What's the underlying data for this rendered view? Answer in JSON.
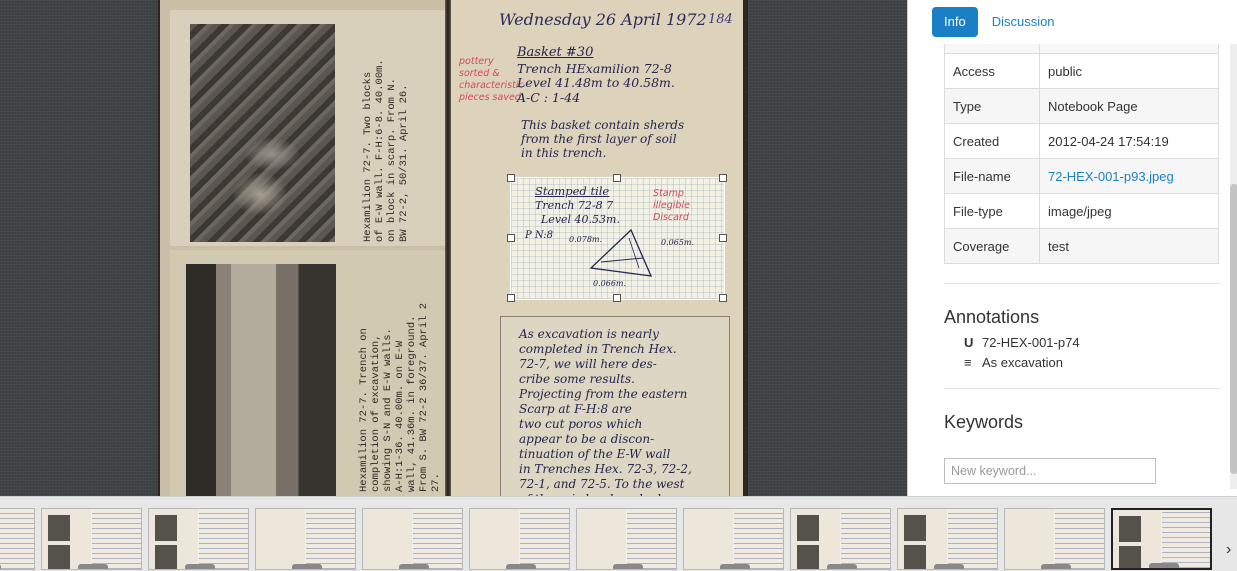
{
  "notebook": {
    "date": "Wednesday 26 April 1972",
    "page_number": "184",
    "red_note": "pottery\nsorted &\ncharacteristic\npieces saved",
    "basket_lines": [
      "Basket #30",
      "Trench HExamilion 72-8",
      "Level 41.48m to 40.58m.",
      "A-C : 1-44"
    ],
    "basket_text": "This basket contain sherds\nfrom the first layer of soil\nin this trench.",
    "stamp_lines": [
      "Stamped tile",
      "Trench 72-8 7",
      "Level 40.53m.",
      "P N:8"
    ],
    "stamp_note": "Stamp\nillegible\nDiscard",
    "measures": [
      "0.078m.",
      "0.065m.",
      "0.066m."
    ],
    "lower_note": "As excavation is nearly\ncompleted in Trench Hex.\n72-7, we will here des-\ncribe some results.\nProjecting from the eastern\nScarp at F-H:8 are\ntwo cut poros which\nappear to be a discon-\ntinuation of the E-W wall\nin Trenches Hex. 72-3, 72-2,\n72-1, and 72-5. To the west\nof these is hard-packed",
    "typed_caption_1": "Hexamilion 72-7. Two blocks\nof E-W wall. F-H:6-8. 40.00m.\non block in scarp. From N.\nBW 72-2, 50/31. April 26.",
    "typed_caption_2": "Hexamilion 72-7. Trench on\ncompletion of excavation,\nshowing S-N and E-W walls.\nA-H:1-36. 40.00m. on E-W\nwall, 41.36m. in foreground.\nFrom S. BW 72-2 36/37. April 2\n27."
  },
  "panel": {
    "tabs": [
      {
        "label": "Info",
        "active": true
      },
      {
        "label": "Discussion",
        "active": false
      }
    ],
    "metadata": [
      {
        "key": "",
        "value": ""
      },
      {
        "key": "Access",
        "value": "public"
      },
      {
        "key": "Type",
        "value": "Notebook Page"
      },
      {
        "key": "Created",
        "value": "2012-04-24 17:54:19"
      },
      {
        "key": "File-name",
        "value": "72-HEX-001-p93.jpeg",
        "link": true
      },
      {
        "key": "File-type",
        "value": "image/jpeg"
      },
      {
        "key": "Coverage",
        "value": "test"
      }
    ],
    "annotations_title": "Annotations",
    "annotations": [
      {
        "icon": "magnet-icon",
        "glyph": "U",
        "label": "72-HEX-001-p74"
      },
      {
        "icon": "list-icon",
        "glyph": "≡",
        "label": "As excavation"
      }
    ],
    "keywords_title": "Keywords",
    "keyword_placeholder": "New keyword..."
  },
  "filmstrip": {
    "thumbnails": [
      {
        "photos": false
      },
      {
        "photos": true
      },
      {
        "photos": true
      },
      {
        "photos": false
      },
      {
        "photos": false
      },
      {
        "photos": false
      },
      {
        "photos": false
      },
      {
        "photos": false
      },
      {
        "photos": true
      },
      {
        "photos": true
      },
      {
        "photos": false
      },
      {
        "photos": true,
        "selected": true
      }
    ]
  },
  "colors": {
    "accent": "#1a7fc4",
    "link": "#1a82c4",
    "red_ink": "#d44a5c",
    "blue_ink": "#252550"
  }
}
